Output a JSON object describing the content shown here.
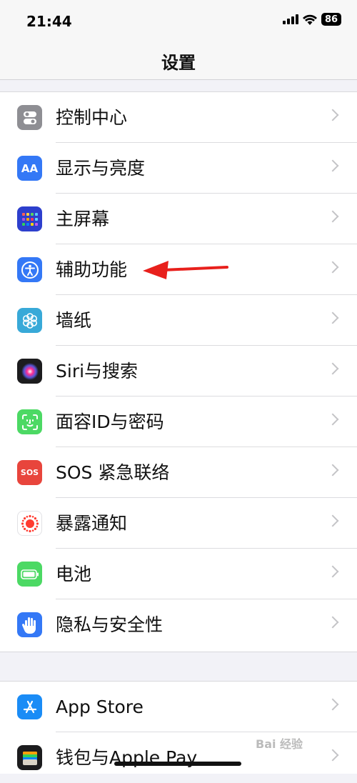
{
  "status_bar": {
    "time": "21:44",
    "battery": "86"
  },
  "nav": {
    "title": "设置"
  },
  "group1": [
    {
      "label": "控制中心",
      "icon": "control-center-icon",
      "color": "#8e8e93"
    },
    {
      "label": "显示与亮度",
      "icon": "display-icon",
      "color": "#3478f6",
      "glyph": "AA"
    },
    {
      "label": "主屏幕",
      "icon": "home-screen-icon",
      "color": "#2d3fcd"
    },
    {
      "label": "辅助功能",
      "icon": "accessibility-icon",
      "color": "#3478f6"
    },
    {
      "label": "墙纸",
      "icon": "wallpaper-icon",
      "color": "#38a9d8"
    },
    {
      "label": "Siri与搜索",
      "icon": "siri-icon",
      "color": "#1c1c1e"
    },
    {
      "label": "面容ID与密码",
      "icon": "face-id-icon",
      "color": "#4cd964"
    },
    {
      "label": "SOS 紧急联络",
      "icon": "sos-icon",
      "color": "#e8453c",
      "glyph": "SOS"
    },
    {
      "label": "暴露通知",
      "icon": "exposure-icon",
      "color": "#ffffff"
    },
    {
      "label": "电池",
      "icon": "battery-icon",
      "color": "#4cd964"
    },
    {
      "label": "隐私与安全性",
      "icon": "privacy-hand-icon",
      "color": "#3478f6"
    }
  ],
  "group2": [
    {
      "label": "App Store",
      "icon": "app-store-icon",
      "color": "#1a8cf6"
    },
    {
      "label": "钱包与Apple Pay",
      "icon": "wallet-icon",
      "color": "#1c1c1e"
    }
  ],
  "watermark": "Bai 经验"
}
